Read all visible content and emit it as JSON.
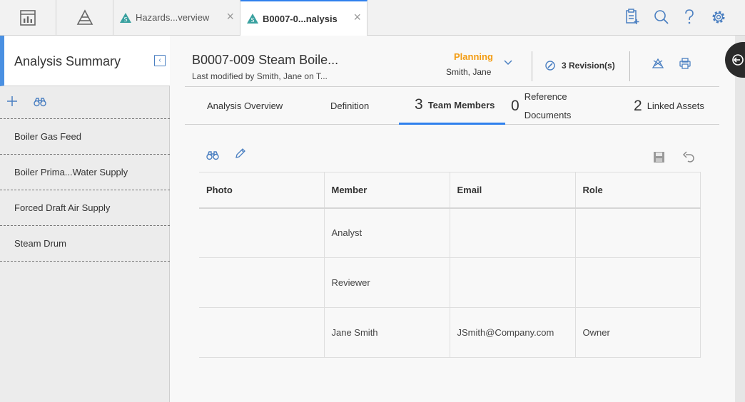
{
  "topbar": {
    "tabs": [
      {
        "label": "Hazards...verview"
      },
      {
        "label": "B0007-0...nalysis"
      }
    ],
    "close_glyph": "×"
  },
  "sidebar": {
    "title": "Analysis Summary",
    "collapse_glyph": "‹",
    "items": [
      {
        "label": "Boiler Gas Feed"
      },
      {
        "label": "Boiler Prima...Water Supply"
      },
      {
        "label": "Forced Draft Air Supply"
      },
      {
        "label": "Steam Drum"
      }
    ]
  },
  "record": {
    "title": "B0007-009 Steam Boile...",
    "subtitle": "Last modified by Smith, Jane on T...",
    "state": "Planning",
    "state_user": "Smith, Jane",
    "revisions": "3 Revision(s)"
  },
  "tabs": [
    {
      "count": "",
      "label": "Analysis Overview"
    },
    {
      "count": "",
      "label": "Definition"
    },
    {
      "count": "3",
      "label": "Team Members"
    },
    {
      "count": "0",
      "label_line1": "Reference",
      "label_line2": "Documents"
    },
    {
      "count": "2",
      "label": "Linked Assets"
    }
  ],
  "grid": {
    "columns": [
      "Photo",
      "Member",
      "Email",
      "Role"
    ],
    "rows": [
      {
        "photo": "",
        "member": "Analyst",
        "email": "",
        "role": ""
      },
      {
        "photo": "",
        "member": "Reviewer",
        "email": "",
        "role": ""
      },
      {
        "photo": "",
        "member": "Jane Smith",
        "email": "JSmith@Company.com",
        "role": "Owner"
      }
    ]
  },
  "colors": {
    "accent": "#2f80ed",
    "state": "#f39c12",
    "icon": "#4a7fc1",
    "tab_icon": "#3aa1a0"
  },
  "icons": {
    "nav_dashboard": "dashboard-icon",
    "nav_hazards": "hazards-pyramid-icon",
    "tab": "hazop-icon",
    "queue": "queue-icon",
    "search": "search-icon",
    "help": "help-icon",
    "settings": "gear-icon",
    "add": "plus-icon",
    "find": "binoculars-icon",
    "edit": "pencil-icon",
    "save": "save-icon",
    "undo": "undo-icon",
    "revision": "compass-icon",
    "mark": "hazard-flag-icon",
    "print": "print-icon",
    "rail": "rail-toggle-icon"
  }
}
